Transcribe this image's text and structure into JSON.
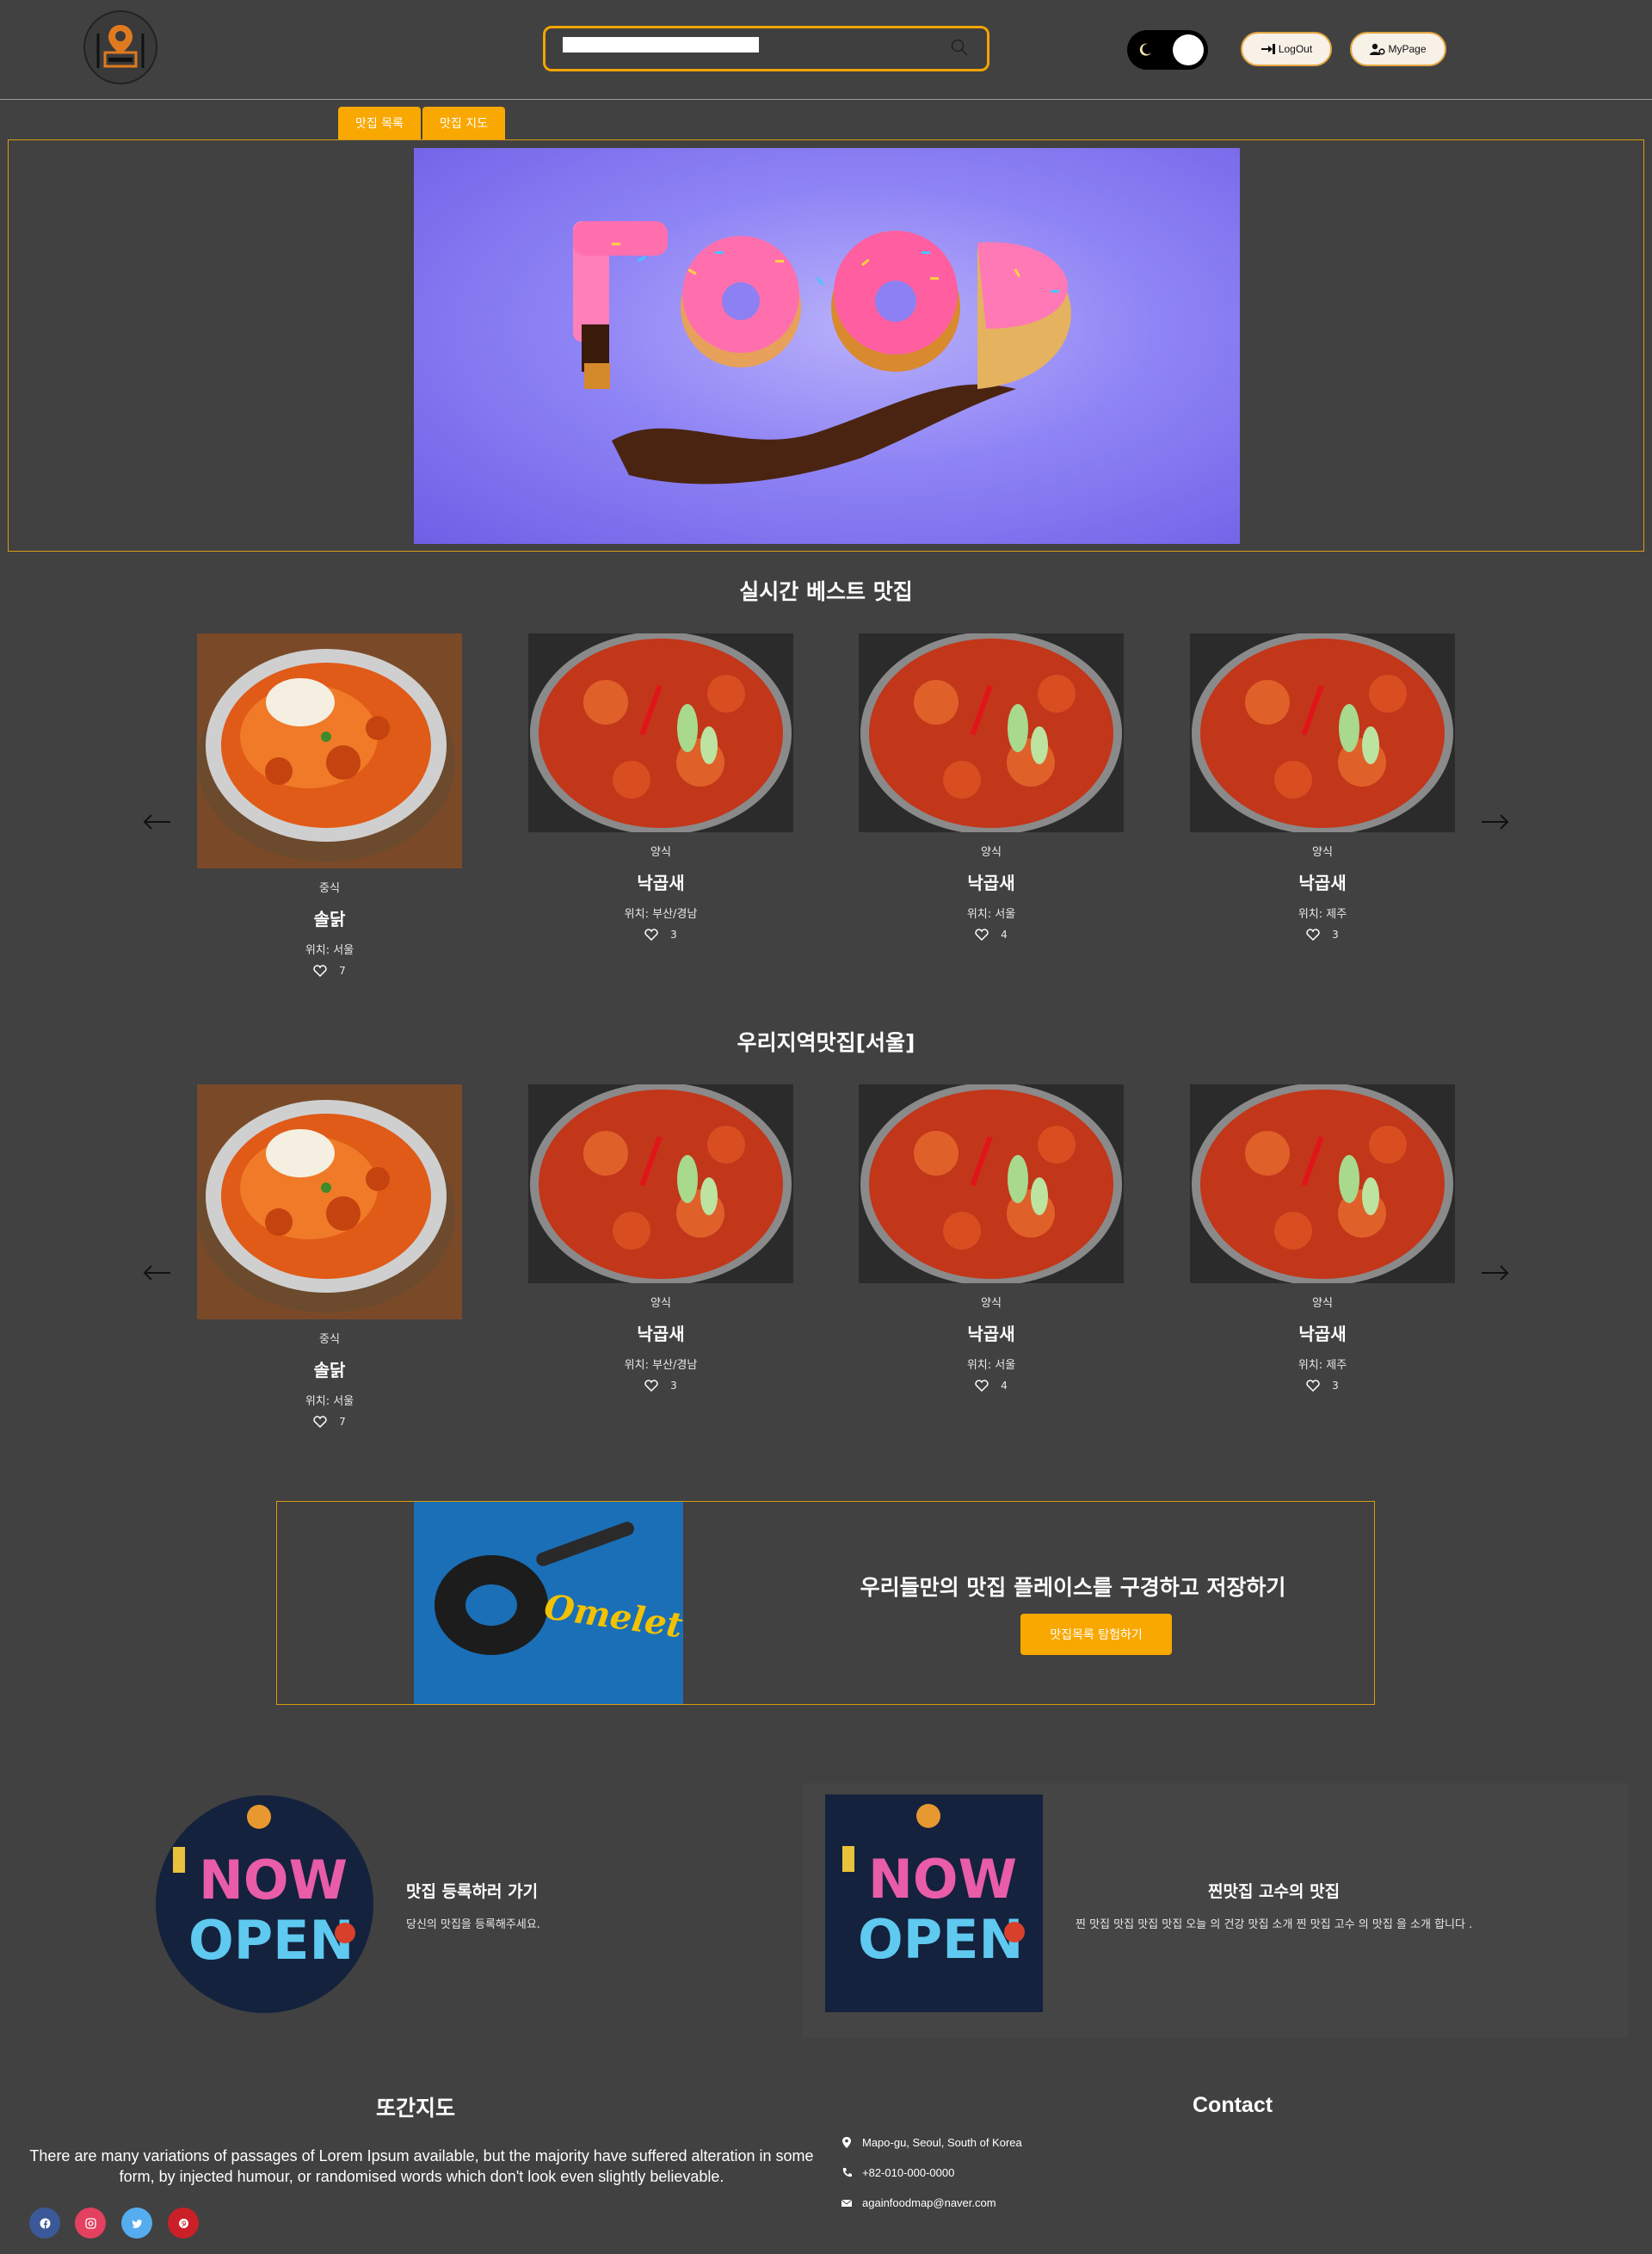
{
  "header": {
    "search_placeholder": "",
    "logout_label": "LogOut",
    "mypage_label": "MyPage"
  },
  "tabs": [
    {
      "label": "맛집 목록"
    },
    {
      "label": "맛집 지도"
    }
  ],
  "best": {
    "title": "실시간 베스트 맛집",
    "cards": [
      {
        "category": "중식",
        "name": "솔닭",
        "location": "위치: 서울",
        "likes": "7"
      },
      {
        "category": "양식",
        "name": "낙곱새",
        "location": "위치: 부산/경남",
        "likes": "3"
      },
      {
        "category": "양식",
        "name": "낙곱새",
        "location": "위치: 서울",
        "likes": "4"
      },
      {
        "category": "양식",
        "name": "낙곱새",
        "location": "위치: 제주",
        "likes": "3"
      }
    ]
  },
  "local": {
    "title": "우리지역맛집[서울]",
    "cards": [
      {
        "category": "중식",
        "name": "솔닭",
        "location": "위치: 서울",
        "likes": "7"
      },
      {
        "category": "양식",
        "name": "낙곱새",
        "location": "위치: 부산/경남",
        "likes": "3"
      },
      {
        "category": "양식",
        "name": "낙곱새",
        "location": "위치: 서울",
        "likes": "4"
      },
      {
        "category": "양식",
        "name": "낙곱새",
        "location": "위치: 제주",
        "likes": "3"
      }
    ]
  },
  "promo": {
    "title": "우리들만의 맛집 플레이스를 구경하고 저장하기",
    "button": "맛집목록 탐험하기",
    "image_text": "Omelette"
  },
  "features": {
    "register": {
      "title": "맛집 등록하러 가기",
      "desc": "당신의 맛집을 등록해주세요."
    },
    "expert": {
      "title": "찐맛집 고수의 맛집",
      "desc": "찐 맛집 맛집 맛집 맛집 오늘 의 건강 맛집 소개 찐 맛집 고수 의 맛집 을 소개 합니다 ."
    },
    "image_text_1": "NOW",
    "image_text_2": "OPEN"
  },
  "banner": {
    "image_text": "FOOD"
  },
  "footer": {
    "brand": "또간지도",
    "text": "There are many variations of passages of Lorem Ipsum available, but the majority have suffered alteration in some form, by injected humour, or randomised words which don't look even slightly believable.",
    "contact_title": "Contact",
    "address": "Mapo-gu, Seoul, South of Korea",
    "phone": "+82-010-000-0000",
    "email": "againfoodmap@naver.com",
    "social": [
      "facebook-icon",
      "instagram-icon",
      "twitter-icon",
      "pinterest-icon"
    ]
  },
  "colors": {
    "background": "#414141",
    "accent": "#f8a800",
    "border": "#d89b10"
  }
}
